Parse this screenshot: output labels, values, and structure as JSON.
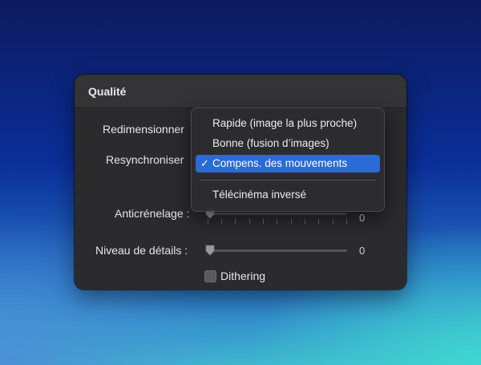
{
  "panel": {
    "title": "Qualité",
    "resize_label": "Redimensionner",
    "resync_label": "Resynchroniser",
    "antialias_label": "Anticrénelage :",
    "antialias_value": "0",
    "detail_label": "Niveau de détails :",
    "detail_value": "0",
    "dithering_label": "Dithering",
    "dithering_checked": false
  },
  "menu": {
    "items": [
      {
        "label": "Rapide (image la plus proche)",
        "selected": false
      },
      {
        "label": "Bonne (fusion d’images)",
        "selected": false
      },
      {
        "label": "Compens. des mouvements",
        "selected": true
      },
      {
        "label": "Télécinéma inversé",
        "selected": false
      }
    ],
    "check_glyph": "✓"
  },
  "colors": {
    "accent": "#2a6bd6",
    "panel_bg": "#2b2b2d",
    "text": "#e6e6e6"
  }
}
